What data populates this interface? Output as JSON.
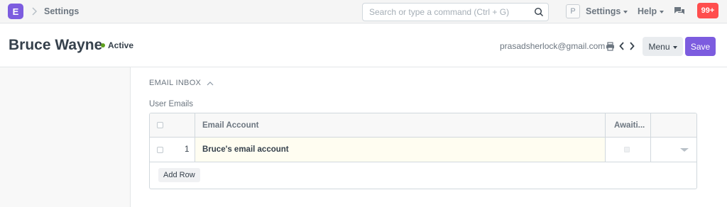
{
  "navbar": {
    "logo_letter": "E",
    "breadcrumb": "Settings",
    "search_placeholder": "Search or type a command (Ctrl + G)",
    "avatar_letter": "P",
    "settings_label": "Settings",
    "help_label": "Help",
    "notification_count": "99+"
  },
  "header": {
    "title": "Bruce Wayne",
    "status": "Active",
    "email": "prasadsherlock@gmail.com",
    "menu_label": "Menu",
    "save_label": "Save"
  },
  "section": {
    "title": "EMAIL INBOX",
    "field_label": "User Emails",
    "table": {
      "columns": [
        "Email Account",
        "Awaiti..."
      ],
      "rows": [
        {
          "idx": "1",
          "email_account": "Bruce's email account"
        }
      ],
      "add_row_label": "Add Row"
    }
  },
  "colors": {
    "brand": "#7c5cdf",
    "notification": "#ff4e4e",
    "status_active": "#5e9f1e"
  },
  "icons": [
    "chevron-right-icon",
    "search-icon",
    "chat-icon",
    "print-icon",
    "chevron-left-icon",
    "chevron-up-icon",
    "caret-down-icon"
  ]
}
